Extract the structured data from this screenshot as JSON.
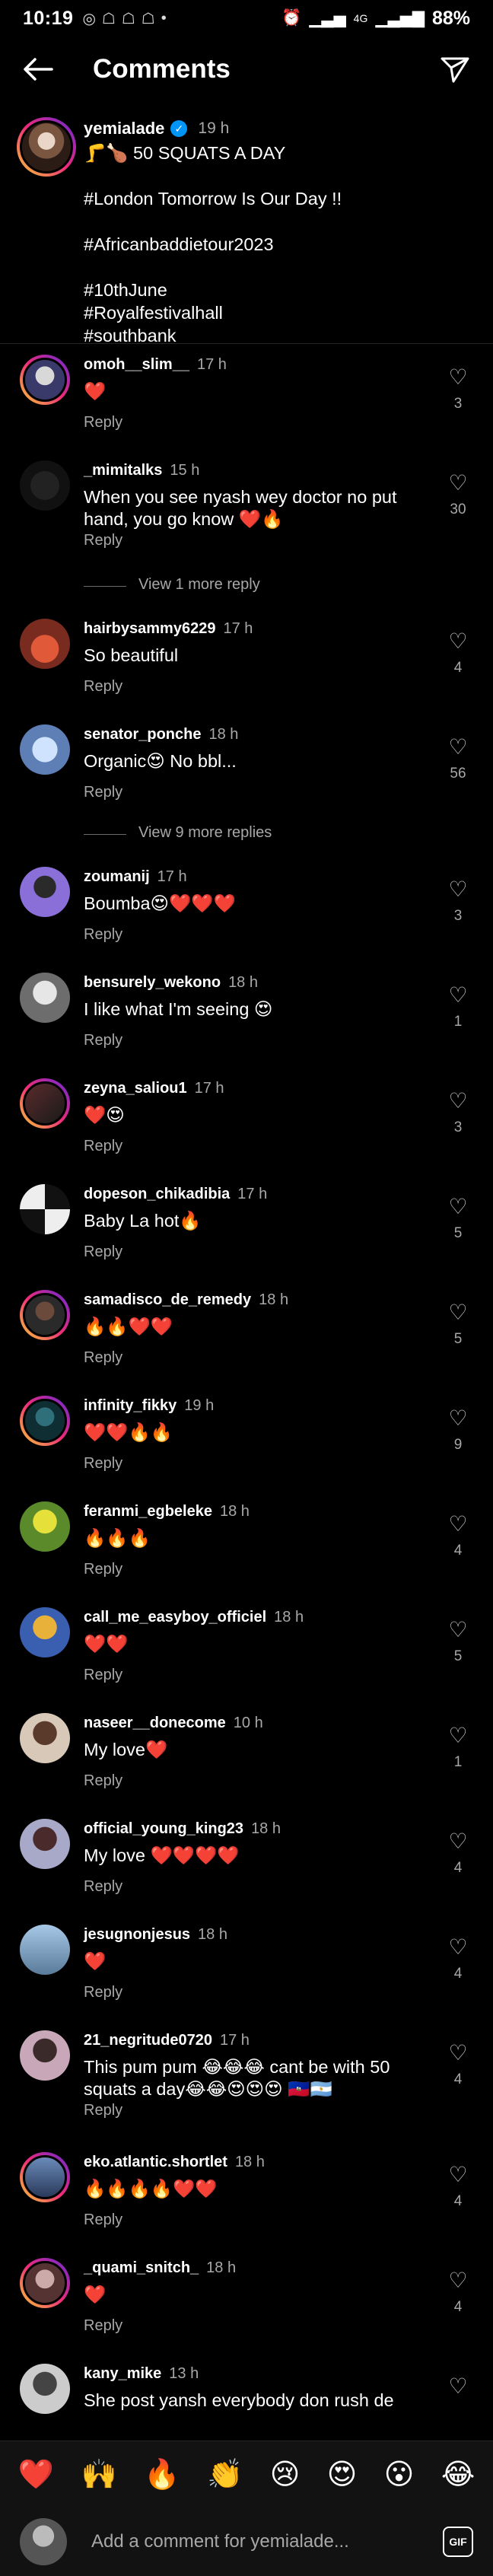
{
  "status_bar": {
    "time": "10:19",
    "network": "4G",
    "battery": "88%"
  },
  "header": {
    "title": "Comments"
  },
  "caption": {
    "username": "yemialade",
    "time": "19 h",
    "lines": [
      "🦵🍗 50 SQUATS A DAY",
      "",
      "#London Tomorrow Is Our Day !!",
      "",
      "#Africanbaddietour2023",
      "",
      "#10thJune",
      "#Royalfestivalhall",
      "#southbank"
    ]
  },
  "comments": [
    {
      "user": "omoh__slim__",
      "time": "17 h",
      "text": "❤️",
      "likes": "3",
      "reply": "Reply"
    },
    {
      "user": "_mimitalks",
      "time": "15 h",
      "text": "When you see nyash wey doctor no put hand, you go know ❤️🔥",
      "likes": "30",
      "reply": "Reply",
      "view_more": "View 1 more reply"
    },
    {
      "user": "hairbysammy6229",
      "time": "17 h",
      "text": "So beautiful",
      "likes": "4",
      "reply": "Reply"
    },
    {
      "user": "senator_ponche",
      "time": "18 h",
      "text": "Organic😍 No bbl...",
      "likes": "56",
      "reply": "Reply",
      "view_more": "View 9 more replies"
    },
    {
      "user": "zoumanij",
      "time": "17 h",
      "text": "Boumba😍❤️❤️❤️",
      "likes": "3",
      "reply": "Reply"
    },
    {
      "user": "bensurely_wekono",
      "time": "18 h",
      "text": "I like what I'm seeing 😍",
      "likes": "1",
      "reply": "Reply"
    },
    {
      "user": "zeyna_saliou1",
      "time": "17 h",
      "text": "❤️😍",
      "likes": "3",
      "reply": "Reply"
    },
    {
      "user": "dopeson_chikadibia",
      "time": "17 h",
      "text": "Baby La hot🔥",
      "likes": "5",
      "reply": "Reply"
    },
    {
      "user": "samadisco_de_remedy",
      "time": "18 h",
      "text": "🔥🔥❤️❤️",
      "likes": "5",
      "reply": "Reply"
    },
    {
      "user": "infinity_fikky",
      "time": "19 h",
      "text": "❤️❤️🔥🔥",
      "likes": "9",
      "reply": "Reply"
    },
    {
      "user": "feranmi_egbeleke",
      "time": "18 h",
      "text": "🔥🔥🔥",
      "likes": "4",
      "reply": "Reply"
    },
    {
      "user": "call_me_easyboy_officiel",
      "time": "18 h",
      "text": "❤️❤️",
      "likes": "5",
      "reply": "Reply"
    },
    {
      "user": "naseer__donecome",
      "time": "10 h",
      "text": "My love❤️",
      "likes": "1",
      "reply": "Reply"
    },
    {
      "user": "official_young_king23",
      "time": "18 h",
      "text": "My love ❤️❤️❤️❤️",
      "likes": "4",
      "reply": "Reply"
    },
    {
      "user": "jesugnonjesus",
      "time": "18 h",
      "text": "❤️",
      "likes": "4",
      "reply": "Reply"
    },
    {
      "user": "21_negritude0720",
      "time": "17 h",
      "text": "This pum pum 😂😂😂 cant be with 50 squats a day😂😂😍😍😍 🇭🇹🇦🇷",
      "likes": "4",
      "reply": "Reply"
    },
    {
      "user": "eko.atlantic.shortlet",
      "time": "18 h",
      "text": "🔥🔥🔥🔥❤️❤️",
      "likes": "4",
      "reply": "Reply"
    },
    {
      "user": "_quami_snitch_",
      "time": "18 h",
      "text": "❤️",
      "likes": "4",
      "reply": "Reply"
    },
    {
      "user": "kany_mike",
      "time": "13 h",
      "text": "She post yansh everybody don rush de",
      "likes": "",
      "reply": ""
    }
  ],
  "emoji_bar": [
    "❤️",
    "🙌",
    "🔥",
    "👏",
    "😢",
    "😍",
    "😮",
    "😂"
  ],
  "input": {
    "placeholder": "Add a comment for yemialade...",
    "gif_label": "GIF"
  }
}
